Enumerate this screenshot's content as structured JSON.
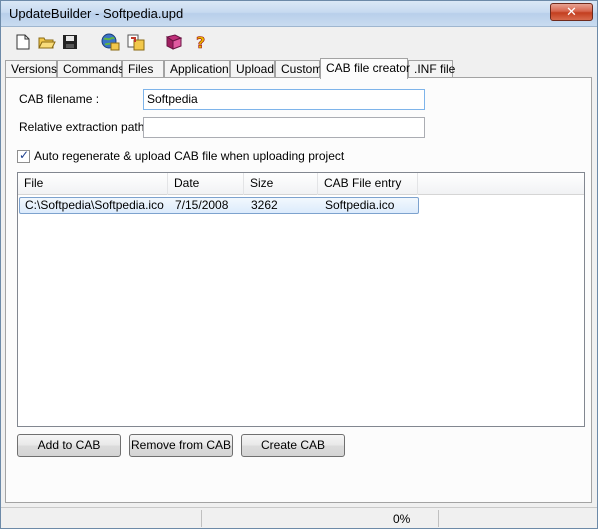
{
  "window": {
    "title": "UpdateBuilder - Softpedia.upd",
    "close_glyph": "✕"
  },
  "toolbar": {
    "icons": [
      "new-file-icon",
      "open-folder-icon",
      "save-icon",
      "build-globe-icon",
      "upload-icon",
      "book-icon",
      "help-icon"
    ]
  },
  "tabs": [
    {
      "label": "Versions"
    },
    {
      "label": "Commands"
    },
    {
      "label": "Files"
    },
    {
      "label": "Application"
    },
    {
      "label": "Upload"
    },
    {
      "label": "Custom"
    },
    {
      "label": "CAB file creator",
      "active": true
    },
    {
      "label": ".INF file"
    }
  ],
  "cab": {
    "filename_label": "CAB filename :",
    "filename_value": "Softpedia",
    "extraction_label": "Relative extraction path :",
    "extraction_value": "",
    "auto_regen_label": "Auto regenerate & upload CAB file when uploading project",
    "auto_regen_checked": true
  },
  "list": {
    "columns": [
      "File",
      "Date",
      "Size",
      "CAB File entry"
    ],
    "rows": [
      {
        "file": "C:\\Softpedia\\Softpedia.ico",
        "date": "7/15/2008",
        "size": "3262",
        "entry": "Softpedia.ico"
      }
    ]
  },
  "buttons": {
    "add": "Add to CAB",
    "remove": "Remove from CAB",
    "create": "Create CAB"
  },
  "status": {
    "progress_text": "0%",
    "progress": 0
  }
}
